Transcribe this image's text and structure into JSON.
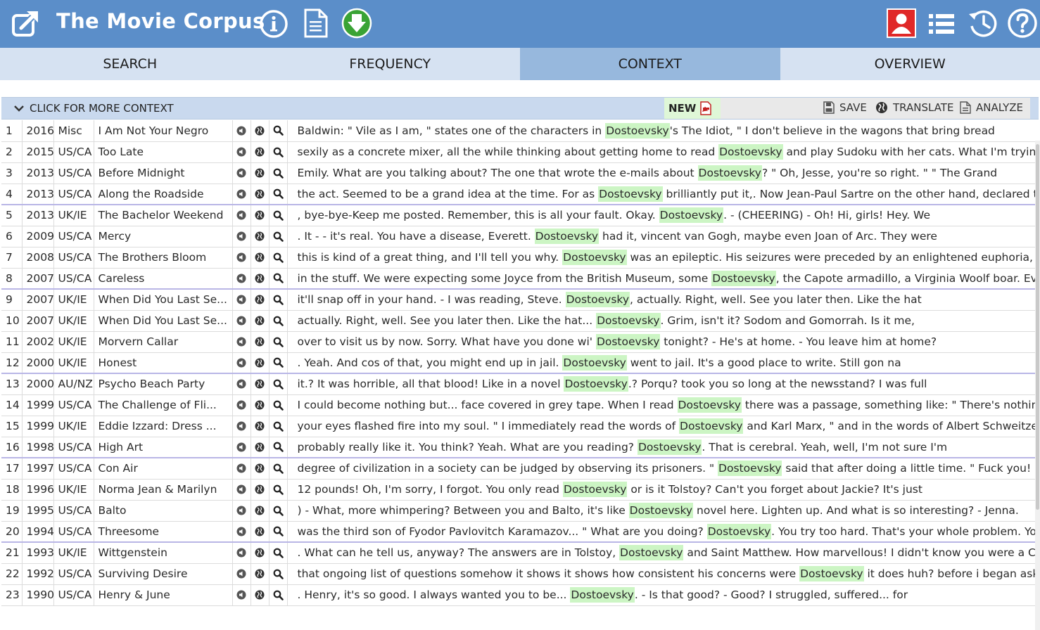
{
  "header": {
    "title": "The Movie Corpus",
    "icons": [
      "external-link-icon",
      "info-icon",
      "document-icon",
      "download-icon",
      "user-icon",
      "list-icon",
      "history-icon",
      "help-icon"
    ]
  },
  "tabs": [
    {
      "label": "SEARCH",
      "active": false
    },
    {
      "label": "FREQUENCY",
      "active": false
    },
    {
      "label": "CONTEXT",
      "active": true
    },
    {
      "label": "OVERVIEW",
      "active": false
    }
  ],
  "toolbar": {
    "more_context": "CLICK FOR MORE CONTEXT",
    "new_label": "NEW",
    "save_label": "SAVE",
    "translate_label": "TRANSLATE",
    "analyze_label": "ANALYZE"
  },
  "colors": {
    "header_bg": "#5b8ec9",
    "tab_active": "#97b8dd",
    "highlight": "#ccf5c4",
    "download_green": "#3aa335",
    "user_red": "#e02828"
  },
  "rows": [
    {
      "n": "1",
      "year": "2016",
      "region": "Misc",
      "title": "I Am Not Your Negro",
      "pre": "Baldwin: \" Vile as I am, \" states one of the characters in ",
      "kw": "Dostoevsky",
      "post": "'s The Idiot, \" I don't believe in the wagons that bring bread"
    },
    {
      "n": "2",
      "year": "2015",
      "region": "US/CA",
      "title": "Too Late",
      "pre": "sexily as a concrete mixer, all the while thinking about getting home to read ",
      "kw": "Dostoevsky",
      "post": " and play Sudoku with her cats. What I'm trying to say is,"
    },
    {
      "n": "3",
      "year": "2013",
      "region": "US/CA",
      "title": "Before Midnight",
      "pre": "Emily. What are you talking about? The one that wrote the e-mails about ",
      "kw": "Dostoevsky",
      "post": "? \" Oh, Jesse, you're so right. \" \" The Grand"
    },
    {
      "n": "4",
      "year": "2013",
      "region": "US/CA",
      "title": "Along the Roadside",
      "pre": "the act. Seemed to be a grand idea at the time. For as ",
      "kw": "Dostoevsky",
      "post": " brilliantly put it,. Now Jean-Paul Sartre on the other hand, declared that"
    },
    {
      "n": "5",
      "year": "2013",
      "region": "UK/IE",
      "title": "The Bachelor Weekend",
      "pre": ", bye-bye-Keep me posted. Remember, this is all your fault. Okay. ",
      "kw": "Dostoevsky",
      "post": ". - (CHEERING) - Oh! Hi, girls! Hey. We"
    },
    {
      "n": "6",
      "year": "2009",
      "region": "US/CA",
      "title": "Mercy",
      "pre": ". It - - it's real. You have a disease, Everett. ",
      "kw": "Dostoevsky",
      "post": " had it, vincent van Gogh, maybe even Joan of Arc. They were"
    },
    {
      "n": "7",
      "year": "2008",
      "region": "US/CA",
      "title": "The Brothers Bloom",
      "pre": "this is kind of a great thing, and I'll tell you why. ",
      "kw": "Dostoevsky",
      "post": " was an epileptic. His seizures were preceded by an enlightened euphoria, a soft"
    },
    {
      "n": "8",
      "year": "2007",
      "region": "US/CA",
      "title": "Careless",
      "pre": "in the stuff. We were expecting some Joyce from the British Museum, some ",
      "kw": "Dostoevsky",
      "post": ", the Capote armadillo, a Virginia Woolf boar. Everything looked"
    },
    {
      "n": "9",
      "year": "2007",
      "region": "UK/IE",
      "title": "When Did You Last Se...",
      "pre": "it'll snap off in your hand. - I was reading, Steve. ",
      "kw": "Dostoevsky",
      "post": ", actually. Right, well. See you later then. Like the hat"
    },
    {
      "n": "10",
      "year": "2007",
      "region": "UK/IE",
      "title": "When Did You Last Se...",
      "pre": "actually. Right, well. See you later then. Like the hat... ",
      "kw": "Dostoevsky",
      "post": ". Grim, isn't it? Sodom and Gomorrah. Is it me,"
    },
    {
      "n": "11",
      "year": "2002",
      "region": "UK/IE",
      "title": "Morvern Callar",
      "pre": "over to visit us by now. Sorry. What have you done wi' ",
      "kw": "Dostoevsky",
      "post": " tonight? - He's at home. - You leave him at home?"
    },
    {
      "n": "12",
      "year": "2000",
      "region": "UK/IE",
      "title": "Honest",
      "pre": ". Yeah. And cos of that, you might end up in jail. ",
      "kw": "Dostoevsky",
      "post": " went to jail. It's a good place to write. Still gon na"
    },
    {
      "n": "13",
      "year": "2000",
      "region": "AU/NZ",
      "title": "Psycho Beach Party",
      "pre": "it.? It was horrible, all that blood! Like in a novel ",
      "kw": "Dostoevsky",
      "post": ".? Porqu? took you so long at the newsstand? I was full"
    },
    {
      "n": "14",
      "year": "1999",
      "region": "US/CA",
      "title": "The Challenge of Fli...",
      "pre": "I could become nothing but... face covered in grey tape. When I read ",
      "kw": "Dostoevsky",
      "post": " there was a passage, something like: \" There's nothing more sad than"
    },
    {
      "n": "15",
      "year": "1999",
      "region": "UK/IE",
      "title": "Eddie Izzard: Dress ...",
      "pre": "your eyes flashed fire into my soul. \" I immediately read the words of ",
      "kw": "Dostoevsky",
      "post": " and Karl Marx, \" and in the words of Albert Schweitzer, I fancy"
    },
    {
      "n": "16",
      "year": "1998",
      "region": "US/CA",
      "title": "High Art",
      "pre": "probably really like it. You think? Yeah. What are you reading? ",
      "kw": "Dostoevsky",
      "post": ". That is cerebral. Yeah, well, I'm not sure I'm"
    },
    {
      "n": "17",
      "year": "1997",
      "region": "US/CA",
      "title": "Con Air",
      "pre": "degree of civilization in a society can be judged by observing its prisoners. \" ",
      "kw": "Dostoevsky",
      "post": " said that after doing a little time. \" Fuck you! \" Cyrus Grissom"
    },
    {
      "n": "18",
      "year": "1996",
      "region": "UK/IE",
      "title": "Norma Jean & Marilyn",
      "pre": "12 pounds! Oh, I'm sorry, I forgot. You only read ",
      "kw": "Dostoevsky",
      "post": " or is it Tolstoy? Can't you forget about Jackie? It's just"
    },
    {
      "n": "19",
      "year": "1995",
      "region": "US/CA",
      "title": "Balto",
      "pre": ") - What, more whimpering? Between you and Balto, it's like ",
      "kw": "Dostoevsky",
      "post": " novel here. Lighten up. And what is so interesting? - Jenna."
    },
    {
      "n": "20",
      "year": "1994",
      "region": "US/CA",
      "title": "Threesome",
      "pre": "was the third son of Fyodor Pavlovitch Karamazov... \" What are you doing? ",
      "kw": "Dostoevsky",
      "post": ". You try too hard. That's your whole problem. You were just"
    },
    {
      "n": "21",
      "year": "1993",
      "region": "UK/IE",
      "title": "Wittgenstein",
      "pre": ". What can he tell us, anyway? The answers are in Tolstoy, ",
      "kw": "Dostoevsky",
      "post": " and Saint Matthew. How marvellous! I didn't know you were a Christian"
    },
    {
      "n": "22",
      "year": "1992",
      "region": "US/CA",
      "title": "Surviving Desire",
      "pre": "that ongoing list of questions somehow it shows it shows how consistent his concerns were ",
      "kw": "Dostoevsky",
      "post": " it does huh? before i began asking those quest"
    },
    {
      "n": "23",
      "year": "1990",
      "region": "US/CA",
      "title": "Henry & June",
      "pre": ". Henry, it's so good. I always wanted you to be... ",
      "kw": "Dostoevsky",
      "post": ". - Is that good? - Good? I struggled, suffered... for"
    }
  ]
}
